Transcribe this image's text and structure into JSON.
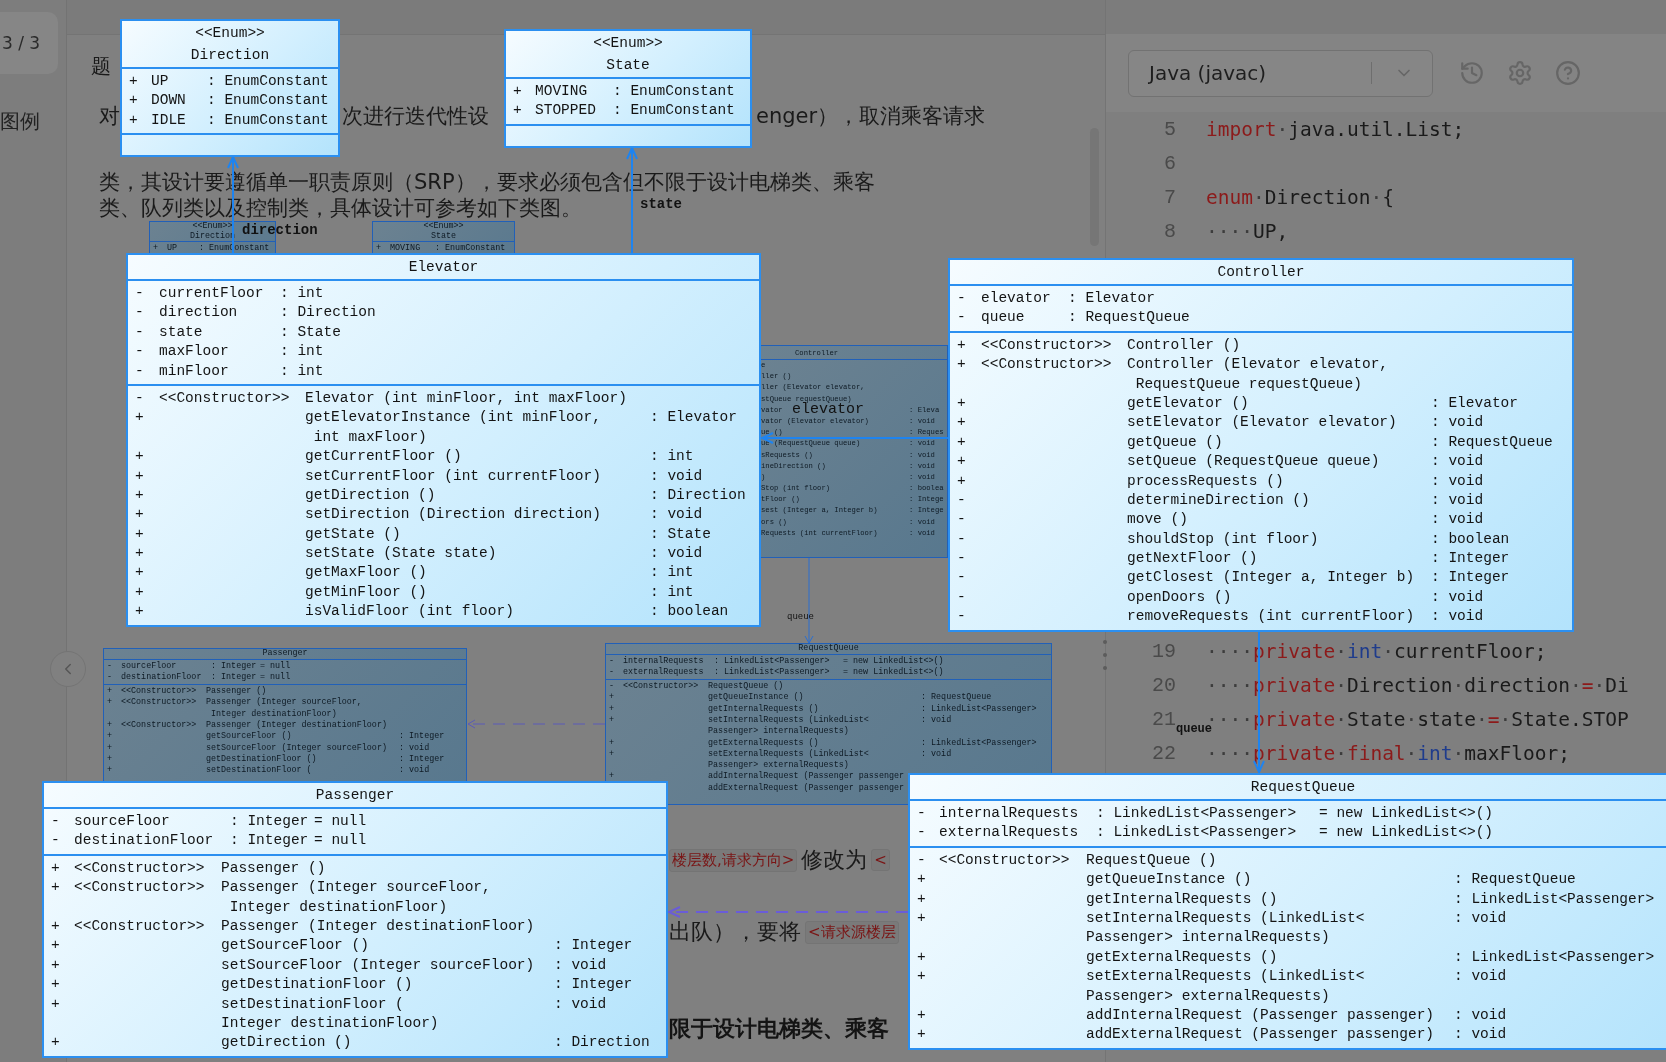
{
  "sidebar": {
    "pager": "3 / 3",
    "legend": "图例"
  },
  "page": {
    "heading": "题",
    "intro_lines": [
      {
        "fragments": [
          "对",
          "次进行迭代性设",
          "enger），取消乘客请求"
        ]
      },
      {
        "fragments": [
          "类，其设计要遵循单一职责原则（SRP），要求必须包含但不限于设计电梯类、乘客"
        ]
      },
      {
        "fragments": [
          "类、队列类以及控制类，具体设计可参考如下类图。"
        ]
      }
    ],
    "lower_lines": [
      {
        "fragments": [
          {
            "kind": "chip",
            "text": "楼层数,请求方向>"
          },
          {
            "kind": "plain",
            "text": "修改为"
          },
          {
            "kind": "chip",
            "text": "<"
          }
        ]
      },
      {
        "fragments": [
          {
            "kind": "plain",
            "text": "出队），要将"
          },
          {
            "kind": "chip",
            "text": "<请求源楼层"
          }
        ]
      },
      {
        "fragments": [
          {
            "kind": "bold",
            "text": "限于设计电梯类、乘客"
          }
        ]
      }
    ]
  },
  "editor": {
    "language": "Java (javac)",
    "code_blocks": [
      [
        {
          "number": "5",
          "tokens": [
            {
              "kind": "keyword",
              "text": "import"
            },
            {
              "kind": "space",
              "text": "·"
            },
            {
              "kind": "plain",
              "text": "java.util.List;"
            }
          ]
        },
        {
          "number": "6"
        },
        {
          "number": "7",
          "tokens": [
            {
              "kind": "keyword",
              "text": "enum"
            },
            {
              "kind": "space",
              "text": "·"
            },
            {
              "kind": "plain",
              "text": "Direction"
            },
            {
              "kind": "space",
              "text": "·"
            },
            {
              "kind": "plain",
              "text": "{"
            }
          ]
        },
        {
          "number": "8",
          "tokens": [
            {
              "kind": "space",
              "text": "····"
            },
            {
              "kind": "plain",
              "text": "UP,"
            }
          ]
        }
      ],
      [
        {
          "number": "19",
          "tokens": [
            {
              "kind": "space",
              "text": "····"
            },
            {
              "kind": "keyword",
              "text": "private"
            },
            {
              "kind": "space",
              "text": "·"
            },
            {
              "kind": "type",
              "text": "int"
            },
            {
              "kind": "space",
              "text": "·"
            },
            {
              "kind": "plain",
              "text": "currentFloor;"
            }
          ]
        },
        {
          "number": "20",
          "tokens": [
            {
              "kind": "space",
              "text": "····"
            },
            {
              "kind": "keyword",
              "text": "private"
            },
            {
              "kind": "space",
              "text": "·"
            },
            {
              "kind": "plain",
              "text": "Direction"
            },
            {
              "kind": "space",
              "text": "·"
            },
            {
              "kind": "plain",
              "text": "direction"
            },
            {
              "kind": "space",
              "text": "·"
            },
            {
              "kind": "keyword",
              "text": "="
            },
            {
              "kind": "space",
              "text": "·"
            },
            {
              "kind": "plain",
              "text": "Di"
            }
          ]
        },
        {
          "number": "21",
          "tokens": [
            {
              "kind": "space",
              "text": "····"
            },
            {
              "kind": "keyword",
              "text": "private"
            },
            {
              "kind": "space",
              "text": "·"
            },
            {
              "kind": "plain",
              "text": "State"
            },
            {
              "kind": "space",
              "text": "·"
            },
            {
              "kind": "plain",
              "text": "state"
            },
            {
              "kind": "space",
              "text": "·"
            },
            {
              "kind": "keyword",
              "text": "="
            },
            {
              "kind": "space",
              "text": "·"
            },
            {
              "kind": "plain",
              "text": "State.STOP"
            }
          ]
        },
        {
          "number": "22",
          "tokens": [
            {
              "kind": "space",
              "text": "····"
            },
            {
              "kind": "keyword",
              "text": "private"
            },
            {
              "kind": "space",
              "text": "·"
            },
            {
              "kind": "keyword",
              "text": "final"
            },
            {
              "kind": "space",
              "text": "·"
            },
            {
              "kind": "type",
              "text": "int"
            },
            {
              "kind": "space",
              "text": "·"
            },
            {
              "kind": "plain",
              "text": "maxFloor;"
            }
          ]
        }
      ]
    ]
  },
  "diagram": {
    "thumbnail": {
      "classes": [
        {
          "stereotype": "<<Enum>>",
          "name": "Direction",
          "attributes": [
            {
              "vis": "+",
              "name": "UP",
              "type": ": EnumConstant"
            }
          ]
        },
        {
          "stereotype": "<<Enum>>",
          "name": "State",
          "attributes": [
            {
              "vis": "+",
              "name": "MOVING",
              "type": ": EnumConstant"
            }
          ]
        },
        {
          "name": "Passenger",
          "attributes": [
            {
              "vis": "-",
              "name": "sourceFloor",
              "type": ": Integer",
              "default": "= null"
            },
            {
              "vis": "-",
              "name": "destinationFloor",
              "type": ": Integer",
              "default": "= null"
            }
          ],
          "methods": [
            {
              "vis": "+",
              "stereotype": "<<Constructor>>",
              "signature": "Passenger ()"
            },
            {
              "vis": "+",
              "stereotype": "<<Constructor>>",
              "signature": "Passenger (Integer sourceFloor,"
            },
            {
              "signature": " Integer destinationFloor)"
            },
            {
              "vis": "+",
              "stereotype": "<<Constructor>>",
              "signature": "Passenger (Integer destinationFloor)"
            },
            {
              "vis": "+",
              "signature": "getSourceFloor ()",
              "returns": ": Integer"
            },
            {
              "vis": "+",
              "signature": "setSourceFloor (Integer sourceFloor)",
              "returns": ": void"
            },
            {
              "vis": "+",
              "signature": "getDestinationFloor ()",
              "returns": ": Integer"
            },
            {
              "vis": "+",
              "signature": "setDestinationFloor (",
              "returns": ": void"
            }
          ]
        },
        {
          "name": "RequestQueue",
          "attributes": [
            {
              "vis": "-",
              "name": "internalRequests",
              "type": ": LinkedList<Passenger>",
              "default": "= new LinkedList<>()"
            },
            {
              "vis": "-",
              "name": "externalRequests",
              "type": ": LinkedList<Passenger>",
              "default": "= new LinkedList<>()"
            }
          ],
          "methods": [
            {
              "vis": "-",
              "stereotype": "<<Constructor>>",
              "signature": "RequestQueue ()"
            },
            {
              "vis": "+",
              "signature": "getQueueInstance ()",
              "returns": ": RequestQueue"
            },
            {
              "vis": "+",
              "signature": "getInternalRequests ()",
              "returns": ": LinkedList<Passenger>"
            },
            {
              "vis": "+",
              "signature": "setInternalRequests (LinkedList<",
              "returns": ": void"
            },
            {
              "signature": "Passenger> internalRequests)"
            },
            {
              "vis": "+",
              "signature": "getExternalRequests ()",
              "returns": ": LinkedList<Passenger>"
            },
            {
              "vis": "+",
              "signature": "setExternalRequests (LinkedList<",
              "returns": ": void"
            },
            {
              "signature": "Passenger> externalRequests)"
            },
            {
              "vis": "+",
              "signature": "addInternalRequest (Passenger passenger"
            },
            {
              "signature": "addExternalRequest (Passenger passenger"
            }
          ]
        }
      ],
      "controller_fragment": {
        "title": "Controller",
        "rows": [
          {
            "text": "e"
          },
          {
            "text": "ller ()"
          },
          {
            "text": "ller (Elevator elevator,"
          },
          {
            "text": "stQueue requestQueue)"
          },
          {
            "text": "vator",
            "returns": ": Eleva"
          },
          {
            "text": "vator (Elevator elevator)",
            "returns": ": void"
          },
          {
            "text": "ue ()",
            "returns": ": Reques"
          },
          {
            "text": "ue (RequestQueue queue)",
            "returns": ": void"
          },
          {
            "text": "sRequests ()",
            "returns": ": void"
          },
          {
            "text": "ineDirection ()",
            "returns": ": void"
          },
          {
            "text": ")",
            "returns": ": void"
          },
          {
            "text": "Stop (int floor)",
            "returns": ": boolea"
          },
          {
            "text": "tFloor ()",
            "returns": ": Intege"
          },
          {
            "text": "sest (Integer a, Integer b)",
            "returns": ": Intege"
          },
          {
            "text": "ors ()",
            "returns": ": void"
          },
          {
            "text": "Requests (int currentFloor)",
            "returns": ": void"
          }
        ]
      }
    },
    "classes": [
      {
        "stereotype": "<<Enum>>",
        "name": "Direction",
        "attributes": [
          {
            "vis": "+",
            "name": "UP",
            "type": ": EnumConstant"
          },
          {
            "vis": "+",
            "name": "DOWN",
            "type": ": EnumConstant"
          },
          {
            "vis": "+",
            "name": "IDLE",
            "type": ": EnumConstant"
          }
        ]
      },
      {
        "stereotype": "<<Enum>>",
        "name": "State",
        "attributes": [
          {
            "vis": "+",
            "name": "MOVING",
            "type": ": EnumConstant"
          },
          {
            "vis": "+",
            "name": "STOPPED",
            "type": ": EnumConstant"
          }
        ]
      },
      {
        "name": "Elevator",
        "attributes": [
          {
            "vis": "-",
            "name": "currentFloor",
            "type": ": int"
          },
          {
            "vis": "-",
            "name": "direction",
            "type": ": Direction"
          },
          {
            "vis": "-",
            "name": "state",
            "type": ": State"
          },
          {
            "vis": "-",
            "name": "maxFloor",
            "type": ": int"
          },
          {
            "vis": "-",
            "name": "minFloor",
            "type": ": int"
          }
        ],
        "methods": [
          {
            "vis": "-",
            "stereotype": "<<Constructor>>",
            "signature": "Elevator (int minFloor, int maxFloor)"
          },
          {
            "vis": "+",
            "signature": "getElevatorInstance (int minFloor,",
            "returns": ": Elevator"
          },
          {
            "signature": " int maxFloor)"
          },
          {
            "vis": "+",
            "signature": "getCurrentFloor ()",
            "returns": ": int"
          },
          {
            "vis": "+",
            "signature": "setCurrentFloor (int currentFloor)",
            "returns": ": void"
          },
          {
            "vis": "+",
            "signature": "getDirection ()",
            "returns": ": Direction"
          },
          {
            "vis": "+",
            "signature": "setDirection (Direction direction)",
            "returns": ": void"
          },
          {
            "vis": "+",
            "signature": "getState ()",
            "returns": ": State"
          },
          {
            "vis": "+",
            "signature": "setState (State state)",
            "returns": ": void"
          },
          {
            "vis": "+",
            "signature": "getMaxFloor ()",
            "returns": ": int"
          },
          {
            "vis": "+",
            "signature": "getMinFloor ()",
            "returns": ": int"
          },
          {
            "vis": "+",
            "signature": "isValidFloor (int floor)",
            "returns": ": boolean"
          }
        ]
      },
      {
        "name": "Controller",
        "attributes": [
          {
            "vis": "-",
            "name": "elevator",
            "type": ": Elevator"
          },
          {
            "vis": "-",
            "name": "queue",
            "type": ": RequestQueue"
          }
        ],
        "methods": [
          {
            "vis": "+",
            "stereotype": "<<Constructor>>",
            "signature": "Controller ()"
          },
          {
            "vis": "+",
            "stereotype": "<<Constructor>>",
            "signature": "Controller (Elevator elevator,"
          },
          {
            "signature": " RequestQueue requestQueue)"
          },
          {
            "vis": "+",
            "signature": "getElevator ()",
            "returns": ": Elevator"
          },
          {
            "vis": "+",
            "signature": "setElevator (Elevator elevator)",
            "returns": ": void"
          },
          {
            "vis": "+",
            "signature": "getQueue ()",
            "returns": ": RequestQueue"
          },
          {
            "vis": "+",
            "signature": "setQueue (RequestQueue queue)",
            "returns": ": void"
          },
          {
            "vis": "+",
            "signature": "processRequests ()",
            "returns": ": void"
          },
          {
            "vis": "-",
            "signature": "determineDirection ()",
            "returns": ": void"
          },
          {
            "vis": "-",
            "signature": "move ()",
            "returns": ": void"
          },
          {
            "vis": "-",
            "signature": "shouldStop (int floor)",
            "returns": ": boolean"
          },
          {
            "vis": "-",
            "signature": "getNextFloor ()",
            "returns": ": Integer"
          },
          {
            "vis": "-",
            "signature": "getClosest (Integer a, Integer b)",
            "returns": ": Integer"
          },
          {
            "vis": "-",
            "signature": "openDoors ()",
            "returns": ": void"
          },
          {
            "vis": "-",
            "signature": "removeRequests (int currentFloor)",
            "returns": ": void"
          }
        ]
      },
      {
        "name": "Passenger",
        "attributes": [
          {
            "vis": "-",
            "name": "sourceFloor",
            "type": ": Integer",
            "default": "= null"
          },
          {
            "vis": "-",
            "name": "destinationFloor",
            "type": ": Integer",
            "default": "= null"
          }
        ],
        "methods": [
          {
            "vis": "+",
            "stereotype": "<<Constructor>>",
            "signature": "Passenger ()"
          },
          {
            "vis": "+",
            "stereotype": "<<Constructor>>",
            "signature": "Passenger (Integer sourceFloor,"
          },
          {
            "signature": " Integer destinationFloor)"
          },
          {
            "vis": "+",
            "stereotype": "<<Constructor>>",
            "signature": "Passenger (Integer destinationFloor)"
          },
          {
            "vis": "+",
            "signature": "getSourceFloor ()",
            "returns": ": Integer"
          },
          {
            "vis": "+",
            "signature": "setSourceFloor (Integer sourceFloor)",
            "returns": ": void"
          },
          {
            "vis": "+",
            "signature": "getDestinationFloor ()",
            "returns": ": Integer"
          },
          {
            "vis": "+",
            "signature": "setDestinationFloor (",
            "returns": ": void"
          },
          {
            "signature": "Integer destinationFloor)"
          },
          {
            "vis": "+",
            "signature": "getDirection ()",
            "returns": ": Direction"
          }
        ]
      },
      {
        "name": "RequestQueue",
        "attributes": [
          {
            "vis": "-",
            "name": "internalRequests",
            "type": ": LinkedList<Passenger>",
            "default": "= new LinkedList<>()"
          },
          {
            "vis": "-",
            "name": "externalRequests",
            "type": ": LinkedList<Passenger>",
            "default": "= new LinkedList<>()"
          }
        ],
        "methods": [
          {
            "vis": "-",
            "stereotype": "<<Constructor>>",
            "signature": "RequestQueue ()"
          },
          {
            "vis": "+",
            "signature": "getQueueInstance ()",
            "returns": ": RequestQueue"
          },
          {
            "vis": "+",
            "signature": "getInternalRequests ()",
            "returns": ": LinkedList<Passenger>"
          },
          {
            "vis": "+",
            "signature": "setInternalRequests (LinkedList<",
            "returns": ": void"
          },
          {
            "signature": "Passenger> internalRequests)"
          },
          {
            "vis": "+",
            "signature": "getExternalRequests ()",
            "returns": ": LinkedList<Passenger>"
          },
          {
            "vis": "+",
            "signature": "setExternalRequests (LinkedList<",
            "returns": ": void"
          },
          {
            "signature": "Passenger> externalRequests)"
          },
          {
            "vis": "+",
            "signature": "addInternalRequest (Passenger passenger)",
            "returns": ": void"
          },
          {
            "vis": "+",
            "signature": "addExternalRequest (Passenger passenger)",
            "returns": ": void"
          }
        ]
      }
    ],
    "labels": [
      {
        "text": "direction"
      },
      {
        "text": "state"
      },
      {
        "text": "elevator"
      },
      {
        "text": "queue"
      },
      {
        "text": "queue"
      }
    ]
  }
}
